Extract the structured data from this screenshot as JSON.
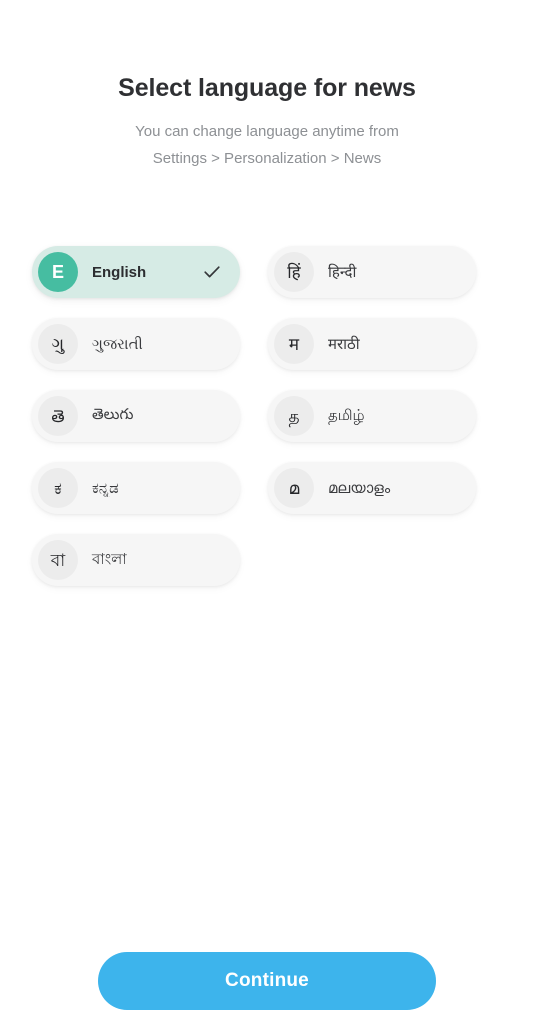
{
  "header": {
    "title": "Select language for news",
    "subtitle_line1": "You can change language anytime from",
    "subtitle_line2": "Settings > Personalization > News"
  },
  "languages": [
    {
      "initial": "E",
      "label": "English",
      "selected": true,
      "check_icon": "check-icon"
    },
    {
      "initial": "हिं",
      "label": "हिन्दी",
      "selected": false,
      "check_icon": "check-icon"
    },
    {
      "initial": "ગુ",
      "label": "ગુજરાતી",
      "selected": false,
      "check_icon": "check-icon"
    },
    {
      "initial": "म",
      "label": "मराठी",
      "selected": false,
      "check_icon": "check-icon"
    },
    {
      "initial": "తె",
      "label": "తెలుగు",
      "selected": false,
      "check_icon": "check-icon"
    },
    {
      "initial": "த",
      "label": "தமிழ்",
      "selected": false,
      "check_icon": "check-icon"
    },
    {
      "initial": "ಕ",
      "label": "ಕನ್ನಡ",
      "selected": false,
      "check_icon": "check-icon"
    },
    {
      "initial": "മ",
      "label": "മലയാളം",
      "selected": false,
      "check_icon": "check-icon"
    },
    {
      "initial": "বা",
      "label": "বাংলা",
      "selected": false,
      "check_icon": "check-icon"
    }
  ],
  "footer": {
    "continue_label": "Continue"
  },
  "colors": {
    "page_background": "#ffffff",
    "title_text": "#2f3033",
    "subtitle_text": "#8d9094",
    "chip_background": "#f6f6f6",
    "chip_avatar_background": "#ececec",
    "chip_selected_background": "#d6ebe5",
    "chip_selected_avatar": "#46bda1",
    "chip_label_text": "#3a3b3e",
    "check_mark": "#35373a",
    "continue_background": "#3db4ec",
    "continue_text": "#ffffff"
  }
}
